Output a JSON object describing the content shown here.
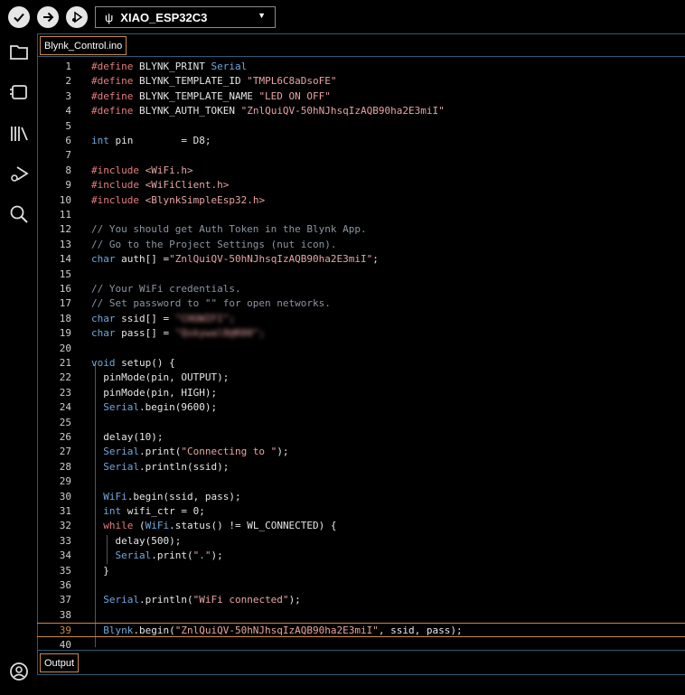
{
  "toolbar": {
    "board_name": "XIAO_ESP32C3",
    "usb_glyph": "ψ"
  },
  "sidebar": {
    "items": [
      "folder-icon",
      "board-icon",
      "library-icon",
      "debug-icon",
      "search-icon"
    ],
    "bottom": "account-icon"
  },
  "editor": {
    "file_tab": "Blynk_Control.ino",
    "current_line": 39,
    "lines": [
      {
        "n": "1",
        "segs": [
          [
            "k",
            "#define "
          ],
          [
            "",
            "BLYNK_PRINT "
          ],
          [
            "t",
            "Serial"
          ]
        ]
      },
      {
        "n": "2",
        "segs": [
          [
            "k",
            "#define "
          ],
          [
            "",
            "BLYNK_TEMPLATE_ID "
          ],
          [
            "s",
            "\"TMPL6C8aDsoFE\""
          ]
        ]
      },
      {
        "n": "3",
        "segs": [
          [
            "k",
            "#define "
          ],
          [
            "",
            "BLYNK_TEMPLATE_NAME "
          ],
          [
            "s",
            "\"LED ON OFF\""
          ]
        ]
      },
      {
        "n": "4",
        "segs": [
          [
            "k",
            "#define "
          ],
          [
            "",
            "BLYNK_AUTH_TOKEN "
          ],
          [
            "s",
            "\"ZnlQuiQV-50hNJhsqIzAQB90ha2E3miI\""
          ]
        ]
      },
      {
        "n": "5",
        "segs": []
      },
      {
        "n": "6",
        "segs": [
          [
            "t",
            "int "
          ],
          [
            "",
            "pin        = D8;"
          ]
        ]
      },
      {
        "n": "7",
        "segs": []
      },
      {
        "n": "8",
        "segs": [
          [
            "k",
            "#include "
          ],
          [
            "s",
            "<WiFi.h>"
          ]
        ]
      },
      {
        "n": "9",
        "segs": [
          [
            "k",
            "#include "
          ],
          [
            "s",
            "<WiFiClient.h>"
          ]
        ]
      },
      {
        "n": "10",
        "segs": [
          [
            "k",
            "#include "
          ],
          [
            "s",
            "<BlynkSimpleEsp32.h>"
          ]
        ]
      },
      {
        "n": "11",
        "segs": []
      },
      {
        "n": "12",
        "segs": [
          [
            "c",
            "// You should get Auth Token in the Blynk App."
          ]
        ]
      },
      {
        "n": "13",
        "segs": [
          [
            "c",
            "// Go to the Project Settings (nut icon)."
          ]
        ]
      },
      {
        "n": "14",
        "segs": [
          [
            "t",
            "char "
          ],
          [
            "",
            "auth[] ="
          ],
          [
            "s",
            "\"ZnlQuiQV-50hNJhsqIzAQB90ha2E3miI\""
          ],
          [
            "",
            ";"
          ]
        ]
      },
      {
        "n": "15",
        "segs": []
      },
      {
        "n": "16",
        "segs": [
          [
            "c",
            "// Your WiFi credentials."
          ]
        ]
      },
      {
        "n": "17",
        "segs": [
          [
            "c",
            "// Set password to \"\" for open networks."
          ]
        ]
      },
      {
        "n": "18",
        "segs": [
          [
            "t",
            "char "
          ],
          [
            "",
            "ssid[] = "
          ],
          [
            "blur",
            "\"CHUWIFI\";"
          ]
        ]
      },
      {
        "n": "19",
        "segs": [
          [
            "t",
            "char "
          ],
          [
            "",
            "pass[] = "
          ],
          [
            "blur",
            "\"Qskywal0@R00\";"
          ]
        ]
      },
      {
        "n": "20",
        "segs": []
      },
      {
        "n": "21",
        "segs": [
          [
            "t",
            "void "
          ],
          [
            "",
            "setup() {"
          ]
        ]
      },
      {
        "n": "22",
        "segs": [
          [
            "",
            "  pinMode(pin, OUTPUT);"
          ]
        ]
      },
      {
        "n": "23",
        "segs": [
          [
            "",
            "  pinMode(pin, HIGH);"
          ]
        ]
      },
      {
        "n": "24",
        "segs": [
          [
            "t",
            "  Serial"
          ],
          [
            "",
            ".begin(9600);"
          ]
        ]
      },
      {
        "n": "25",
        "segs": []
      },
      {
        "n": "26",
        "segs": [
          [
            "",
            "  delay(10);"
          ]
        ]
      },
      {
        "n": "27",
        "segs": [
          [
            "t",
            "  Serial"
          ],
          [
            "",
            ".print("
          ],
          [
            "s",
            "\"Connecting to \""
          ],
          [
            "",
            ");"
          ]
        ]
      },
      {
        "n": "28",
        "segs": [
          [
            "t",
            "  Serial"
          ],
          [
            "",
            ".println(ssid);"
          ]
        ]
      },
      {
        "n": "29",
        "segs": []
      },
      {
        "n": "30",
        "segs": [
          [
            "t",
            "  WiFi"
          ],
          [
            "",
            ".begin(ssid, pass);"
          ]
        ]
      },
      {
        "n": "31",
        "segs": [
          [
            "t",
            "  int "
          ],
          [
            "",
            "wifi_ctr = 0;"
          ]
        ]
      },
      {
        "n": "32",
        "segs": [
          [
            "k",
            "  while "
          ],
          [
            "",
            "("
          ],
          [
            "t",
            "WiFi"
          ],
          [
            "",
            ".status() != WL_CONNECTED) {"
          ]
        ]
      },
      {
        "n": "33",
        "segs": [
          [
            "",
            "    delay(500);"
          ]
        ]
      },
      {
        "n": "34",
        "segs": [
          [
            "t",
            "    Serial"
          ],
          [
            "",
            ".print("
          ],
          [
            "s",
            "\".\""
          ],
          [
            "",
            ");"
          ]
        ]
      },
      {
        "n": "35",
        "segs": [
          [
            "",
            "  }"
          ]
        ]
      },
      {
        "n": "36",
        "segs": []
      },
      {
        "n": "37",
        "segs": [
          [
            "t",
            "  Serial"
          ],
          [
            "",
            ".println("
          ],
          [
            "s",
            "\"WiFi connected\""
          ],
          [
            "",
            ");"
          ]
        ]
      },
      {
        "n": "38",
        "segs": []
      },
      {
        "n": "39",
        "segs": [
          [
            "t",
            "  Blynk"
          ],
          [
            "",
            ".begin("
          ],
          [
            "s",
            "\"ZnlQuiQV-50hNJhsqIzAQB90ha2E3miI\""
          ],
          [
            "",
            ", ssid, pass);"
          ]
        ]
      },
      {
        "n": "40",
        "segs": []
      }
    ]
  },
  "output_tab": "Output",
  "colors": {
    "accent": "#c98a42",
    "divider": "#2d5b73"
  }
}
